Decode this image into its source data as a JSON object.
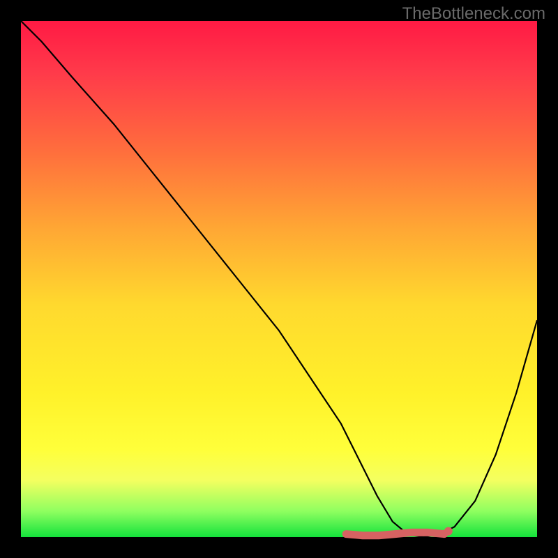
{
  "watermark": "TheBottleneck.com",
  "chart_data": {
    "type": "line",
    "title": "",
    "xlabel": "",
    "ylabel": "",
    "xlim": [
      0,
      100
    ],
    "ylim": [
      0,
      100
    ],
    "series": [
      {
        "name": "bottleneck-curve",
        "x": [
          0,
          4,
          10,
          18,
          26,
          34,
          42,
          50,
          56,
          62,
          66,
          69,
          72,
          75,
          78,
          81,
          84,
          88,
          92,
          96,
          100
        ],
        "values": [
          100,
          96,
          89,
          80,
          70,
          60,
          50,
          40,
          31,
          22,
          14,
          8,
          3,
          0.5,
          0,
          0.5,
          2,
          7,
          16,
          28,
          42
        ]
      }
    ],
    "flat_segment": {
      "name": "minimum-band",
      "x_start": 63,
      "x_end": 82,
      "y": 0.6,
      "color": "#d66262"
    },
    "gradient_stops": [
      {
        "pos": 0,
        "color": "#ff1a44"
      },
      {
        "pos": 25,
        "color": "#ff6d3d"
      },
      {
        "pos": 55,
        "color": "#ffd92e"
      },
      {
        "pos": 83,
        "color": "#ffff3a"
      },
      {
        "pos": 100,
        "color": "#14e23c"
      }
    ]
  }
}
